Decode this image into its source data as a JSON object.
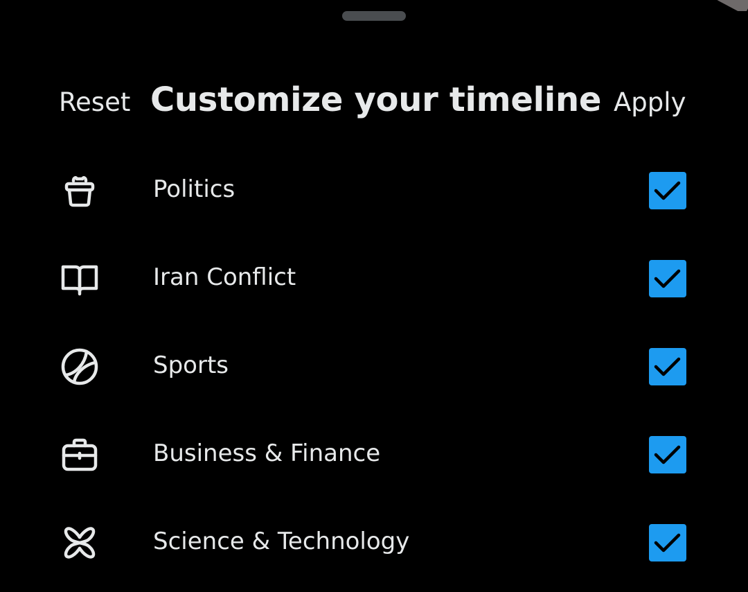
{
  "header": {
    "reset_label": "Reset",
    "title": "Customize your timeline",
    "apply_label": "Apply"
  },
  "topics": [
    {
      "label": "Politics",
      "icon": "podium-icon",
      "checked": true
    },
    {
      "label": "Iran Conflict",
      "icon": "book-icon",
      "checked": true
    },
    {
      "label": "Sports",
      "icon": "ball-icon",
      "checked": true
    },
    {
      "label": "Business & Finance",
      "icon": "briefcase-icon",
      "checked": true
    },
    {
      "label": "Science & Technology",
      "icon": "atom-icon",
      "checked": true
    }
  ],
  "colors": {
    "background": "#000000",
    "text": "#e7e9ea",
    "accent": "#1d9bf0",
    "grabber": "#4a4d50"
  }
}
